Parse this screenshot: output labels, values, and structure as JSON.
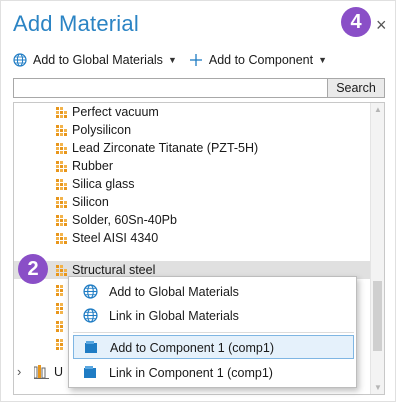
{
  "window": {
    "title": "Add Material",
    "close_glyph": "×"
  },
  "badges": {
    "top": "4",
    "left": "2"
  },
  "toolbar": {
    "global_label": "Add to Global Materials",
    "component_label": "Add to Component",
    "caret": "▼"
  },
  "search": {
    "value": "",
    "button_label": "Search"
  },
  "tree": {
    "materials": [
      "Perfect vacuum",
      "Polysilicon",
      "Lead Zirconate Titanate (PZT-5H)",
      "Rubber",
      "Silica glass",
      "Silicon",
      "Solder, 60Sn-40Pb",
      "Steel AISI 4340",
      "Structural steel"
    ],
    "selected_index": 8,
    "bottom_node_truncated": "U",
    "icons": {
      "material": "material-grid-icon",
      "library": "library-books-icon",
      "expand": "chevron-right-icon"
    }
  },
  "context_menu": {
    "items": [
      {
        "label": "Add to Global Materials",
        "icon": "globe-icon"
      },
      {
        "label": "Link in Global Materials",
        "icon": "globe-icon"
      },
      {
        "label": "Add to Component 1 (comp1)",
        "icon": "component-icon",
        "highlighted": true
      },
      {
        "label": "Link in Component 1 (comp1)",
        "icon": "component-icon"
      }
    ]
  },
  "colors": {
    "title": "#2b84c4",
    "badge": "#8a4fc7",
    "material_icon": "#e8961b",
    "component_icon": "#1f7cc4",
    "menu_highlight": "#e5f1fb"
  }
}
